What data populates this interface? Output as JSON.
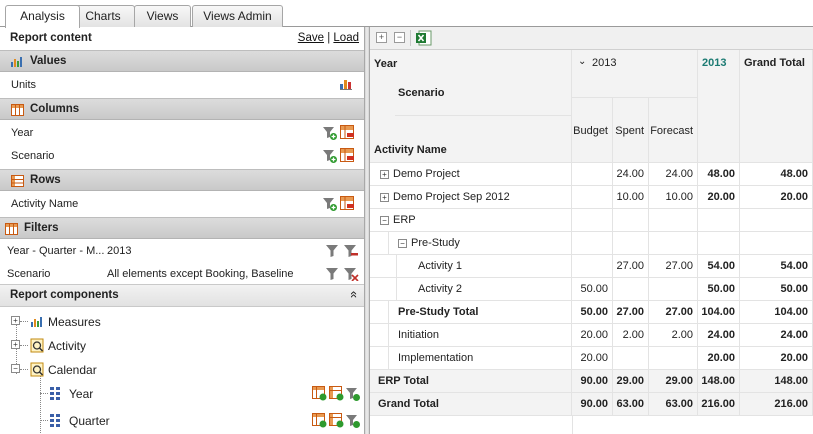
{
  "tabs": [
    "Analysis",
    "Charts",
    "Views",
    "Views Admin"
  ],
  "report_content": {
    "title": "Report content",
    "save": "Save",
    "separator": "|",
    "load": "Load"
  },
  "values": {
    "title": "Values",
    "items": [
      {
        "label": "Units"
      }
    ]
  },
  "columns": {
    "title": "Columns",
    "items": [
      {
        "label": "Year"
      },
      {
        "label": "Scenario"
      }
    ]
  },
  "rows": {
    "title": "Rows",
    "items": [
      {
        "label": "Activity Name"
      }
    ]
  },
  "filters": {
    "title": "Filters",
    "items": [
      {
        "label": "Year - Quarter - M...",
        "value": "2013"
      },
      {
        "label": "Scenario",
        "value": "All elements except Booking, Baseline"
      }
    ]
  },
  "report_components": {
    "title": "Report components",
    "collapse_glyph": "«",
    "items": [
      "Measures",
      "Activity",
      "Calendar",
      "Year",
      "Quarter"
    ]
  },
  "pivot": {
    "year_label": "Year",
    "scenario_label": "Scenario",
    "activity_label": "Activity Name",
    "year_value": "2013",
    "year_total": "2013",
    "grand_total_header": "Grand Total",
    "scenarios": [
      "Budget",
      "Spent",
      "Forecast"
    ],
    "rows": [
      {
        "name": "Demo Project",
        "expander": "+",
        "budget": "",
        "spent": "24.00",
        "forecast": "24.00",
        "year_total": "48.00",
        "grand_total": "48.00"
      },
      {
        "name": "Demo Project Sep 2012",
        "expander": "+",
        "budget": "",
        "spent": "10.00",
        "forecast": "10.00",
        "year_total": "20.00",
        "grand_total": "20.00"
      },
      {
        "name": "ERP",
        "expander": "−",
        "budget": "",
        "spent": "",
        "forecast": "",
        "year_total": "",
        "grand_total": ""
      },
      {
        "name": "Pre-Study",
        "expander": "−",
        "budget": "",
        "spent": "",
        "forecast": "",
        "year_total": "",
        "grand_total": ""
      },
      {
        "name": "Activity 1",
        "budget": "",
        "spent": "27.00",
        "forecast": "27.00",
        "year_total": "54.00",
        "grand_total": "54.00"
      },
      {
        "name": "Activity 2",
        "budget": "50.00",
        "spent": "",
        "forecast": "",
        "year_total": "50.00",
        "grand_total": "50.00"
      },
      {
        "name": "Pre-Study Total",
        "budget": "50.00",
        "spent": "27.00",
        "forecast": "27.00",
        "year_total": "104.00",
        "grand_total": "104.00"
      },
      {
        "name": "Initiation",
        "budget": "20.00",
        "spent": "2.00",
        "forecast": "2.00",
        "year_total": "24.00",
        "grand_total": "24.00"
      },
      {
        "name": "Implementation",
        "budget": "20.00",
        "spent": "",
        "forecast": "",
        "year_total": "20.00",
        "grand_total": "20.00"
      },
      {
        "name": "ERP Total",
        "budget": "90.00",
        "spent": "29.00",
        "forecast": "29.00",
        "year_total": "148.00",
        "grand_total": "148.00"
      },
      {
        "name": "Grand Total",
        "budget": "90.00",
        "spent": "63.00",
        "forecast": "63.00",
        "year_total": "216.00",
        "grand_total": "216.00"
      }
    ]
  },
  "colors": {
    "accent_teal": "#1b7a72",
    "header_gray": "#d3d3d3",
    "filter_icon_red": "#c0302a"
  }
}
